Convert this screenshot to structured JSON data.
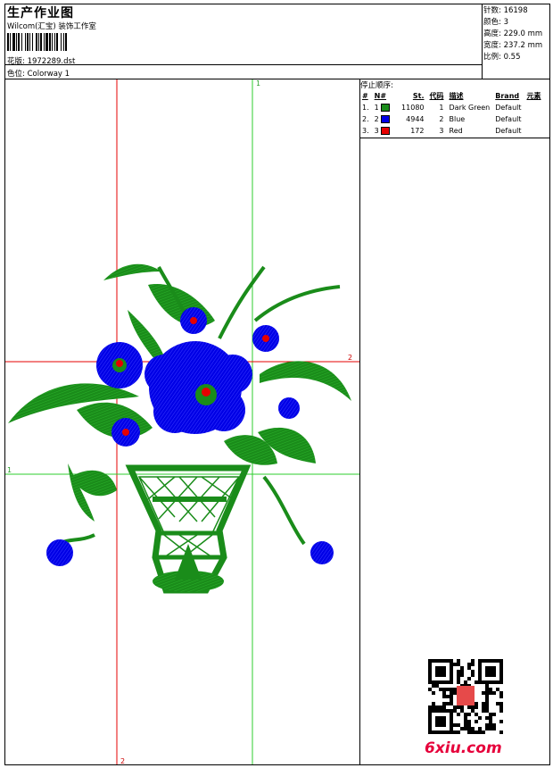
{
  "header": {
    "title": "生产作业图",
    "company": "Wilcom(汇宝) 装饰工作室",
    "design_label": "花版: 1972289.dst",
    "colorway_label": "色位: Colorway 1"
  },
  "stats": {
    "stitches": "针数: 16198",
    "colors": "颜色: 3",
    "height": "高度: 229.0 mm",
    "width": "宽度: 237.2 mm",
    "scale": "比例: 0.55"
  },
  "stop_sequence": {
    "title": "停止顺序:",
    "columns": [
      "#",
      "N#",
      "St.",
      "代码",
      "描述",
      "Brand",
      "元素"
    ],
    "rows": [
      {
        "idx": "1.",
        "n": "1",
        "color": "#1a8c1a",
        "st": "11080",
        "code": "1",
        "desc": "Dark Green",
        "brand": "Default"
      },
      {
        "idx": "2.",
        "n": "2",
        "color": "#0000e6",
        "st": "4944",
        "code": "2",
        "desc": "Blue",
        "brand": "Default"
      },
      {
        "idx": "3.",
        "n": "3",
        "color": "#e60000",
        "st": "172",
        "code": "3",
        "desc": "Red",
        "brand": "Default"
      }
    ]
  },
  "guides": {
    "v_green_label": "1",
    "h_red_label": "2",
    "h_green_label": "1",
    "v_red_label": "2"
  },
  "colors": {
    "green": "#1a8c1a",
    "blue": "#0000e6",
    "red": "#e60000",
    "guide_red": "#e60000",
    "guide_green": "#2ecc2e"
  },
  "watermark": "6xiu.com"
}
